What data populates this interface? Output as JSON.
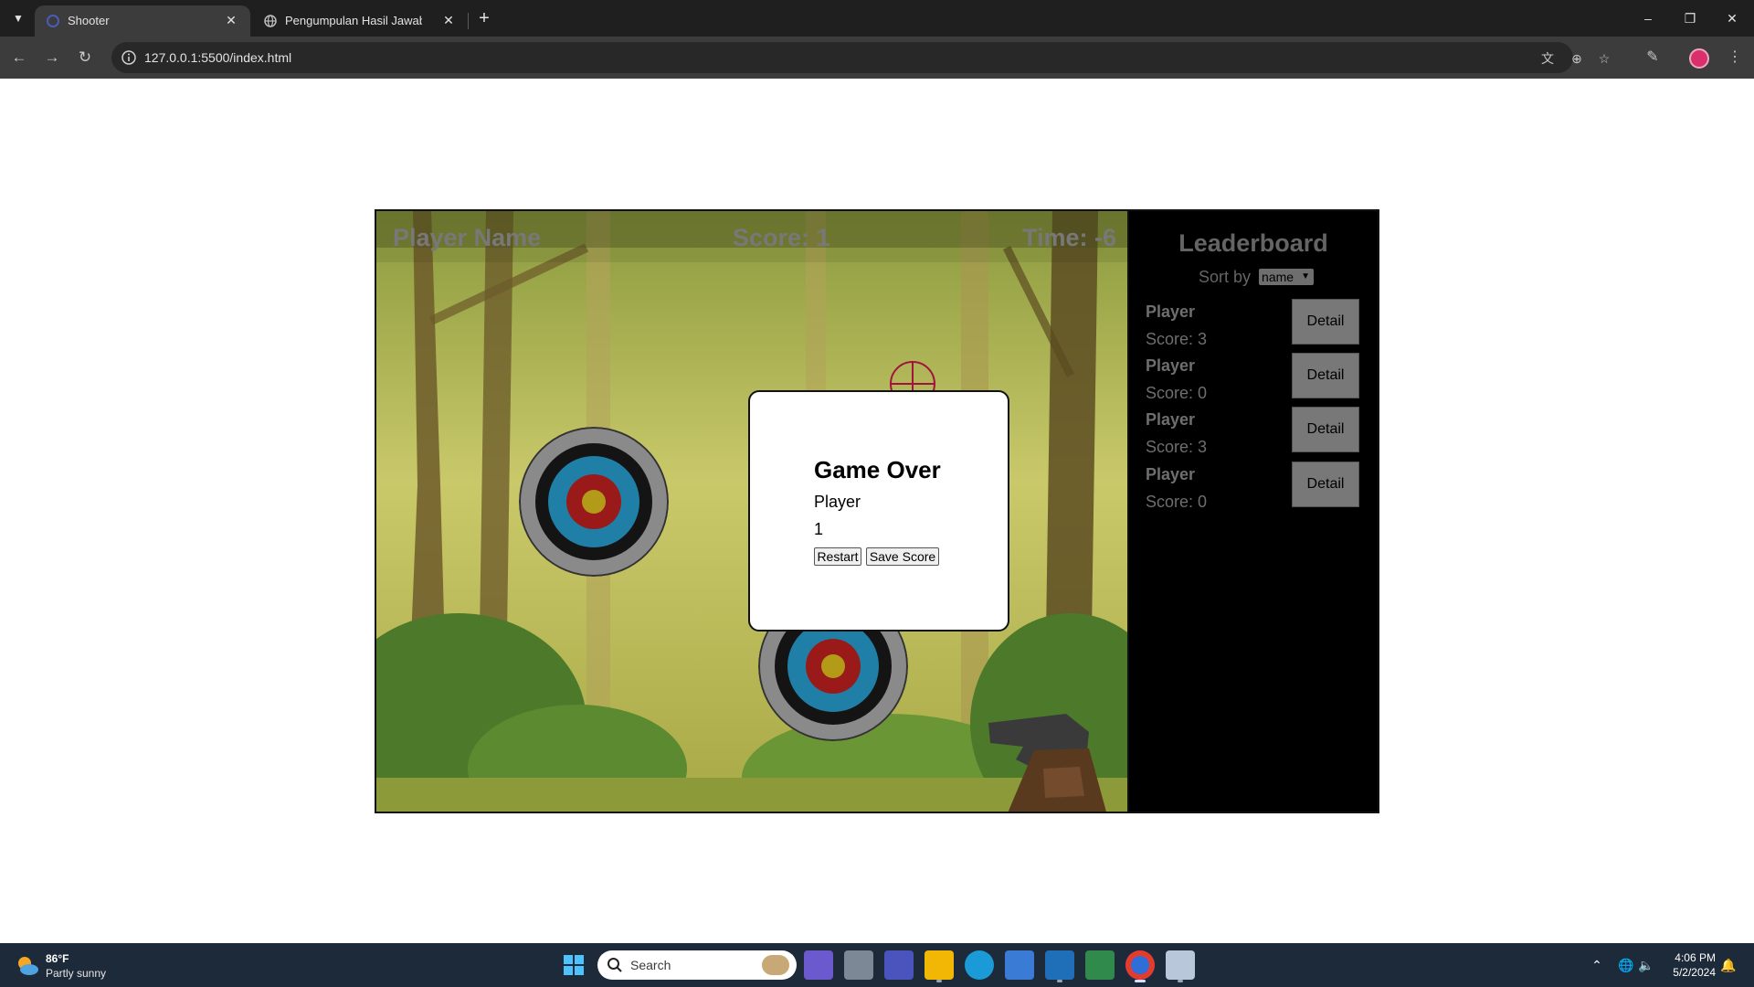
{
  "browser": {
    "tabs": [
      {
        "title": "Shooter",
        "active": true
      },
      {
        "title": "Pengumpulan Hasil Jawaban LK",
        "active": false
      }
    ],
    "url": "127.0.0.1:5500/index.html"
  },
  "game": {
    "hud": {
      "player_label": "Player Name",
      "score_label": "Score: 1",
      "time_label": "Time: -6"
    },
    "modal": {
      "title": "Game Over",
      "player": "Player",
      "score": "1",
      "restart_label": "Restart",
      "save_label": "Save Score"
    }
  },
  "leaderboard": {
    "title": "Leaderboard",
    "sort_label": "Sort by",
    "sort_value": "name",
    "detail_label": "Detail",
    "entries": [
      {
        "name": "Player",
        "score": "Score: 3"
      },
      {
        "name": "Player",
        "score": "Score: 0"
      },
      {
        "name": "Player",
        "score": "Score: 3"
      },
      {
        "name": "Player",
        "score": "Score: 0"
      }
    ]
  },
  "taskbar": {
    "weather_temp": "86°F",
    "weather_desc": "Partly sunny",
    "search_placeholder": "Search",
    "time": "4:06 PM",
    "date": "5/2/2024"
  },
  "colors": {
    "hud_text": "#787878",
    "leaderboard_bg": "#000000",
    "detail_button": "#787878",
    "target_ring_blue": "#1f7fa6",
    "target_ring_red": "#9a1a1a",
    "target_center": "#b39a18"
  }
}
